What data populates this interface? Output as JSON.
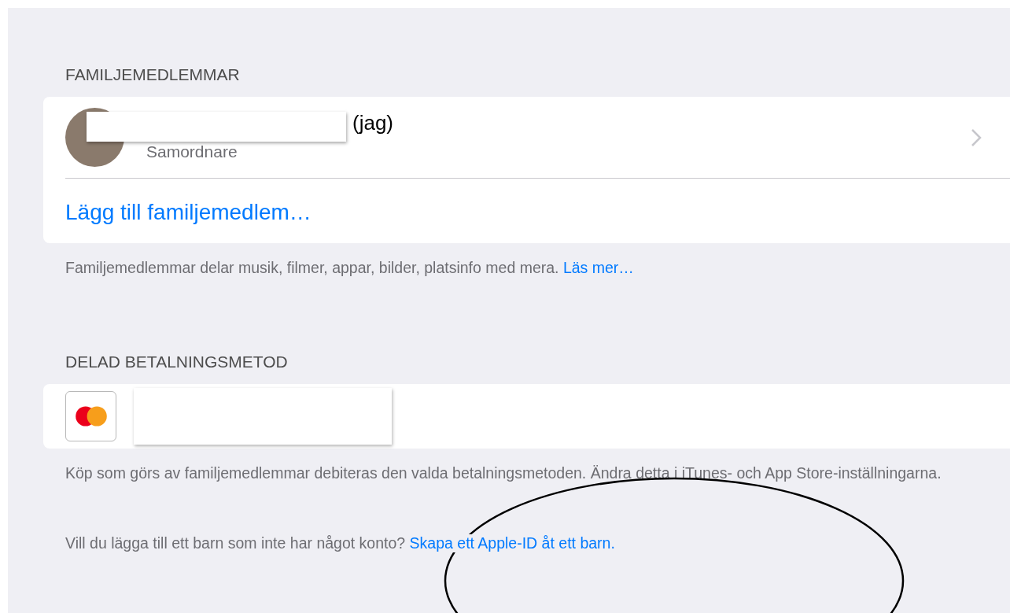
{
  "sections": [
    {
      "kind": "members",
      "header": "FAMILJEMEDLEMMAR",
      "members": [
        {
          "suffix": "(jag)",
          "role": "Samordnare"
        }
      ],
      "action": "Lägg till familjemedlem…",
      "footer": "Familjemedlemmar delar musik, filmer, appar, bilder, platsinfo med mera.",
      "footer_link": "Läs mer…"
    },
    {
      "kind": "payment",
      "header": "DELAD BETALNINGSMETOD",
      "footer": "Köp som görs av familjemedlemmar debiteras den valda betalningsmetoden. Ändra detta i iTunes- och App Store-inställningarna."
    }
  ],
  "bottom": {
    "text": "Vill du lägga till ett barn som inte har något konto?",
    "link": "Skapa ett Apple-ID åt ett barn."
  }
}
